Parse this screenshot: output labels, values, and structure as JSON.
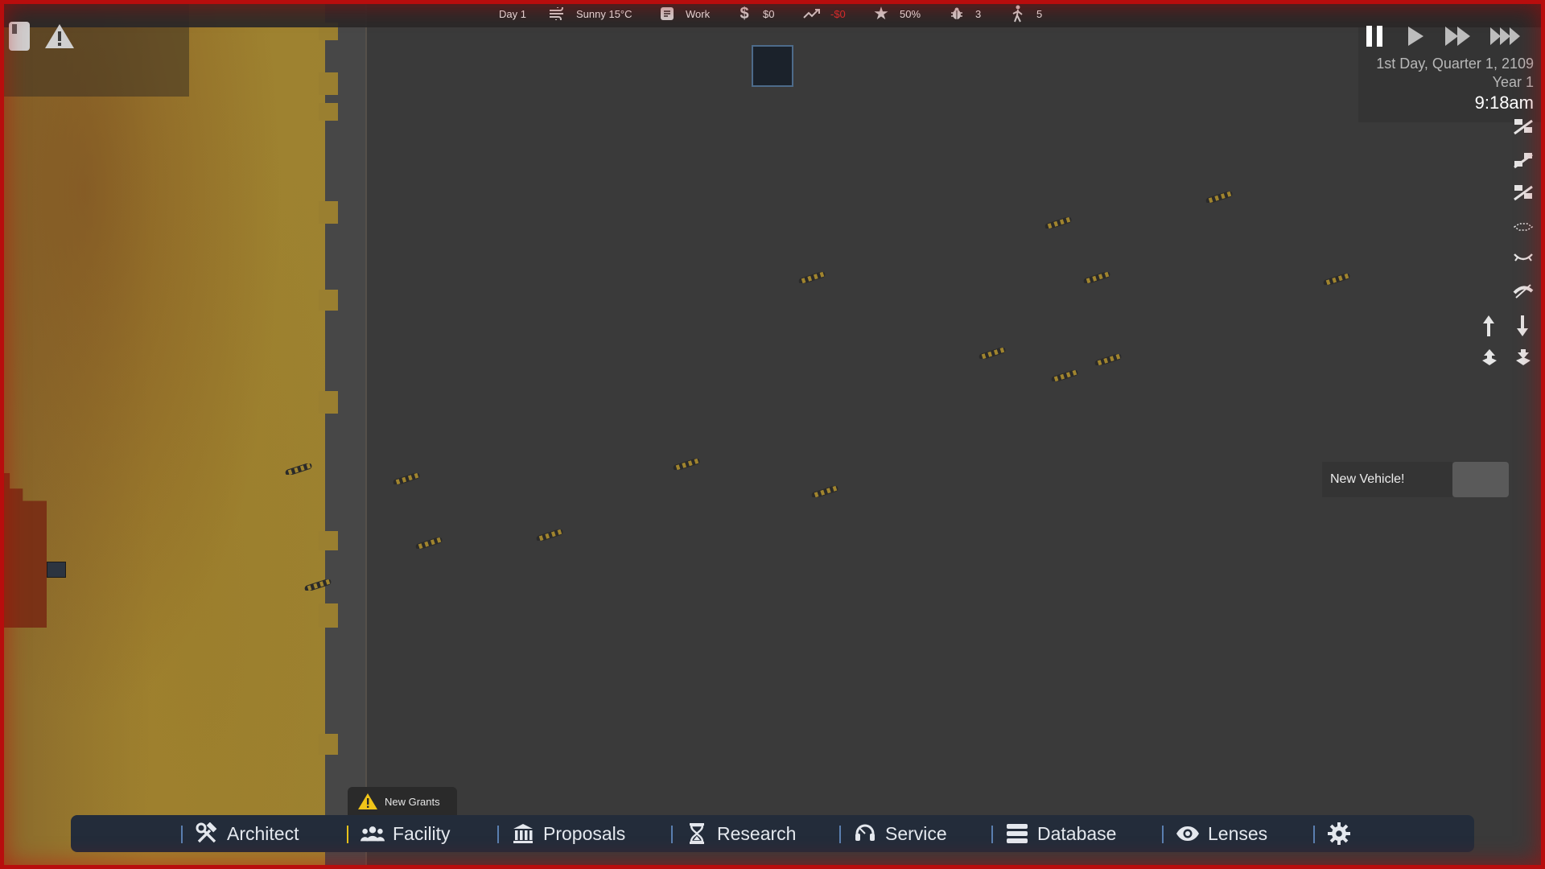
{
  "status_bar": {
    "day": "Day 1",
    "weather": "Sunny 15°C",
    "shift": "Work",
    "money": "$0",
    "income": "-$0",
    "rating": "50%",
    "bugs": "3",
    "staff": "5"
  },
  "time_controls": {
    "date": "1st Day, Quarter 1, 2109",
    "year": "Year 1",
    "time": "9:18am"
  },
  "notification": {
    "label": "New Vehicle!"
  },
  "grants_tab": {
    "label": "New Grants"
  },
  "toolbar": {
    "items": [
      {
        "label": "Architect",
        "icon": "hammer-wrench-icon"
      },
      {
        "label": "Facility",
        "icon": "people-icon"
      },
      {
        "label": "Proposals",
        "icon": "bank-icon"
      },
      {
        "label": "Research",
        "icon": "hourglass-icon"
      },
      {
        "label": "Service",
        "icon": "headset-icon"
      },
      {
        "label": "Database",
        "icon": "database-icon"
      },
      {
        "label": "Lenses",
        "icon": "eye-icon"
      }
    ],
    "settings_icon": "gear-icon",
    "active_item": "Facility"
  },
  "colors": {
    "toolbar_bg": "#232c3a",
    "separator": "#5a7fb0",
    "separator_active": "#e8c21a",
    "warning_yellow": "#f0c419",
    "negative_red": "#d83030",
    "alert_border": "#b80d0d"
  }
}
